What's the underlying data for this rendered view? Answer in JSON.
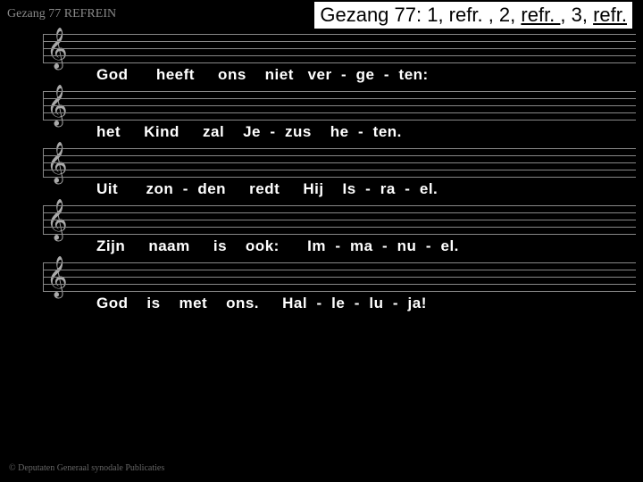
{
  "header": {
    "small_label": "Gezang 77  REFREIN",
    "main_prefix": "Gezang 77: 1, refr. , 2, ",
    "main_u1": "refr. ",
    "main_mid": ", 3, ",
    "main_u2": "refr."
  },
  "lines": [
    {
      "lyric": "God      heeft     ons    niet   ver  -  ge  -  ten:"
    },
    {
      "lyric": "het     Kind     zal    Je  -  zus    he  -  ten."
    },
    {
      "lyric": "Uit      zon  -  den     redt     Hij    Is  -  ra  -  el."
    },
    {
      "lyric": "Zijn     naam     is    ook:      Im  -  ma  -  nu  -  el."
    },
    {
      "lyric": "God    is    met    ons.     Hal  -  le  -  lu  -  ja!"
    }
  ],
  "copyright": "© Deputaten Generaal synodale Publicaties"
}
